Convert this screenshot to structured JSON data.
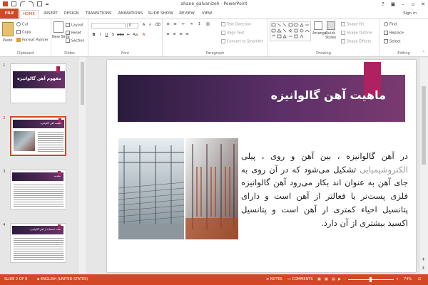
{
  "window": {
    "title": "ahane_galvanizeh - PowerPoint",
    "help": "?",
    "minimize": "–",
    "restore": "▫",
    "close": "✕"
  },
  "tabs": [
    "FILE",
    "HOME",
    "INSERT",
    "DESIGN",
    "TRANSITIONS",
    "ANIMATIONS",
    "SLIDE SHOW",
    "REVIEW",
    "VIEW"
  ],
  "active_tab": "HOME",
  "signin": "Sign in",
  "ribbon": {
    "clipboard": {
      "label": "Clipboard",
      "paste": "Paste",
      "cut": "Cut",
      "copy": "Copy",
      "format_painter": "Format Painter"
    },
    "slides": {
      "label": "Slides",
      "new_slide": "New Slide",
      "layout": "Layout",
      "reset": "Reset",
      "section": "Section"
    },
    "font": {
      "label": "Font",
      "size": "0",
      "bold": "B",
      "italic": "I",
      "underline": "U",
      "strike": "S",
      "aa": "Aa"
    },
    "paragraph": {
      "label": "Paragraph",
      "text_direction": "Text Direction",
      "align_text": "Align Text",
      "convert": "Convert to SmartArt"
    },
    "drawing": {
      "label": "Drawing",
      "arrange": "Arrange",
      "quick_styles": "Quick Styles",
      "shape_fill": "Shape Fill",
      "shape_outline": "Shape Outline",
      "shape_effects": "Shape Effects"
    },
    "editing": {
      "label": "Editing",
      "find": "Find",
      "replace": "Replace",
      "select": "Select"
    }
  },
  "thumbnails": [
    {
      "num": "1",
      "title": "مفهوم آهن گالوانیزه"
    },
    {
      "num": "2",
      "title": "ماهیت آهن گالوانیزه"
    },
    {
      "num": "3",
      "title": "مقدمه"
    },
    {
      "num": "4",
      "title": "علت استفاده از آهن گالوانیزه"
    }
  ],
  "slide": {
    "title": "ماهیت آهن گالوانیزه",
    "body_a": "در آهن گالوانیزه ، بین آهن و روی ، پیلی ",
    "body_hl": "الکتروشیمیایی",
    "body_b": " تشکیل می‌شود که در آن روی به جای آهن به عنوان اند بکار می‌رود آهن گالوانیزه فلزی پست‌تر یا فعالتر از آهن است و دارای پتانسیل احیاء کمتری از آهن است و پتانسیل اکسید بیشتری از آن دارد."
  },
  "status": {
    "slide": "SLIDE 2 OF 8",
    "language": "ENGLISH (UNITED STATES)",
    "notes": "NOTES",
    "comments": "COMMENTS",
    "zoom": "74%",
    "zoom_minus": "-",
    "zoom_plus": "+"
  },
  "colors": {
    "accent": "#d24726",
    "slide_band": "#4a2858",
    "slide_tab": "#b0215f"
  }
}
